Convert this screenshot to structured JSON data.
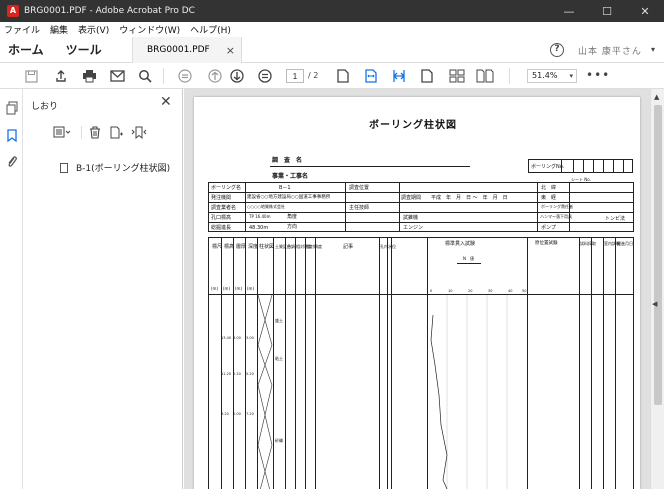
{
  "window": {
    "title": "BRG0001.PDF - Adobe Acrobat Pro DC",
    "app_icon": "acrobat-icon",
    "controls": {
      "minimize": "—",
      "maximize": "☐",
      "close": "✕"
    }
  },
  "menu": {
    "items": [
      "ファイル",
      "編集",
      "表示(V)",
      "ウィンドウ(W)",
      "ヘルプ(H)"
    ]
  },
  "tabs": {
    "home": "ホーム",
    "tools": "ツール",
    "document": "BRG0001.PDF",
    "close": "×",
    "help": "?",
    "user": "山本 康平さん"
  },
  "toolbar": {
    "page_current": "1",
    "page_total": "/ 2",
    "zoom": "51.4%",
    "more": "•••",
    "icons": [
      "save-icon",
      "upload-icon",
      "print-icon",
      "email-icon",
      "search-icon",
      "scroll-mode-icon",
      "prev-page-icon",
      "next-page-icon",
      "fit-page-icon",
      "single-page-icon",
      "fit-width-icon",
      "crop-icon",
      "page-icon",
      "page-layout-icon",
      "two-page-icon"
    ]
  },
  "bookmarks": {
    "title": "しおり",
    "close": "✕",
    "items": [
      {
        "label": "B-1(ボーリング柱状図)"
      }
    ]
  },
  "pdf": {
    "title": "ボーリング柱状図",
    "survey_name_label": "調　査　名",
    "project_name_label": "事業・工事名",
    "boring_no_label": "ボーリングNo.",
    "sheet_label": "シート No.",
    "header_rows": [
      {
        "c1": "ボーリング名",
        "c2": "B－1",
        "c3": "調査位置",
        "c4": "",
        "c5": "北　緯"
      },
      {
        "c1": "発注機関",
        "c2": "建設省○○地方建設局○○国道工事事務所",
        "c3": "調査期間",
        "c4": "平成　年　月　日 ～　年　月　日",
        "c5": "東　経"
      },
      {
        "c1": "調査業者名",
        "c2": "○○○○地質株式会社",
        "c3": "主任技師",
        "c4": "",
        "c5": "ボーリング責任者"
      },
      {
        "c1": "孔口標高",
        "c2": "TP 16.40m",
        "c3": "角度",
        "c4": "試錐機",
        "c5": "ハンマー落下用具"
      },
      {
        "c1": "総掘進長",
        "c2": "48.30m",
        "c3": "方向",
        "c4": "エンジン",
        "c5": "ポンプ"
      }
    ],
    "header_extra": {
      "spt_device": "トンビ法",
      "legend_n": "N　値"
    },
    "columns": [
      "標尺",
      "標高",
      "層厚",
      "深度",
      "柱状図",
      "土質区分",
      "色調",
      "相対密度",
      "相対稠度",
      "記事"
    ],
    "columns_units": [
      "(m)",
      "(m)",
      "(m)",
      "(m)"
    ],
    "spt_headers": [
      "孔内水位",
      "標準貫入試験",
      "原位置試験",
      "試料採取",
      "室内試験",
      "掘進月日"
    ],
    "spt_scale": [
      "0",
      "10",
      "20",
      "30",
      "40",
      "50"
    ],
    "elevations": [
      "13.40",
      "11.20",
      "9.20"
    ],
    "layer_thickness": [
      "3.00",
      "2.20",
      "2.00"
    ],
    "depths": [
      "3.00",
      "5.20",
      "7.20"
    ],
    "soil_labels": [
      "盛土",
      "粘土",
      "砂礫"
    ]
  },
  "colors": {
    "titlebar_bg": "#333333",
    "accent": "#1473e6",
    "acrobat_red": "#d7261e"
  }
}
